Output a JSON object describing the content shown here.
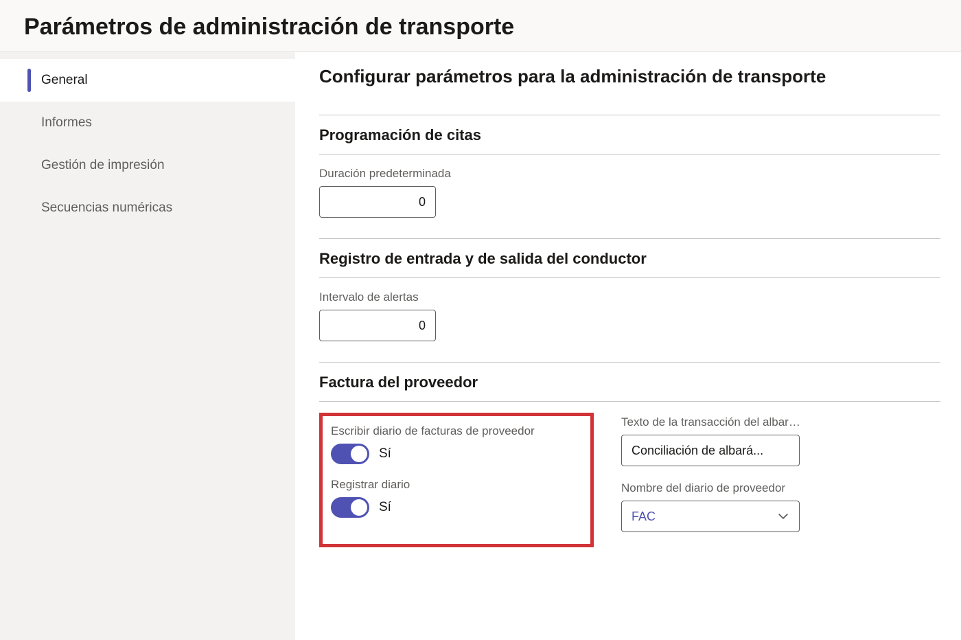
{
  "page_title": "Parámetros de administración de transporte",
  "sidebar": {
    "items": [
      {
        "label": "General",
        "active": true
      },
      {
        "label": "Informes",
        "active": false
      },
      {
        "label": "Gestión de impresión",
        "active": false
      },
      {
        "label": "Secuencias numéricas",
        "active": false
      }
    ]
  },
  "main": {
    "title": "Configurar parámetros para la administración de transporte",
    "sections": {
      "appointment": {
        "title": "Programación de citas",
        "default_duration_label": "Duración predeterminada",
        "default_duration_value": "0"
      },
      "driver_check": {
        "title": "Registro de entrada y de salida del conductor",
        "alert_interval_label": "Intervalo de alertas",
        "alert_interval_value": "0"
      },
      "vendor_invoice": {
        "title": "Factura del proveedor",
        "write_journal_label": "Escribir diario de facturas de proveedor",
        "write_journal_state": "Sí",
        "post_journal_label": "Registrar diario",
        "post_journal_state": "Sí",
        "transaction_text_label": "Texto de la transacción del albarán de ...",
        "transaction_text_value": "Conciliación de albará...",
        "journal_name_label": "Nombre del diario de proveedor",
        "journal_name_value": "FAC"
      }
    }
  },
  "colors": {
    "accent": "#4f52b2",
    "highlight_border": "#d13438"
  }
}
